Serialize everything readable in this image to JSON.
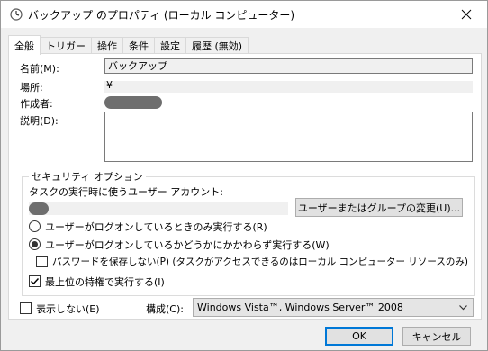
{
  "window": {
    "title": "バックアップ のプロパティ (ローカル コンピューター)"
  },
  "tabs": [
    {
      "label": "全般"
    },
    {
      "label": "トリガー"
    },
    {
      "label": "操作"
    },
    {
      "label": "条件"
    },
    {
      "label": "設定"
    },
    {
      "label": "履歴 (無効)"
    }
  ],
  "general": {
    "name_label": "名前(M):",
    "name_value": "バックアップ",
    "location_label": "場所:",
    "location_value": "¥",
    "author_label": "作成者:",
    "description_label": "説明(D):",
    "description_value": ""
  },
  "security": {
    "group_title": "セキュリティ オプション",
    "account_label": "タスクの実行時に使うユーザー アカウント:",
    "change_user_button": "ユーザーまたはグループの変更(U)...",
    "radio_logged_on": "ユーザーがログオンしているときのみ実行する(R)",
    "radio_whether_logged_on": "ユーザーがログオンしているかどうかにかかわらず実行する(W)",
    "selected_radio": "whether_logged_on",
    "no_store_password": "パスワードを保存しない(P) (タスクがアクセスできるのはローカル コンピューター リソースのみ)",
    "no_store_password_checked": false,
    "highest_privileges": "最上位の特権で実行する(I)",
    "highest_privileges_checked": true
  },
  "bottom": {
    "hidden_label": "表示しない(E)",
    "hidden_checked": false,
    "configure_label": "構成(C):",
    "configure_value": "Windows Vista™, Windows Server™ 2008"
  },
  "footer": {
    "ok": "OK",
    "cancel": "キャンセル"
  }
}
